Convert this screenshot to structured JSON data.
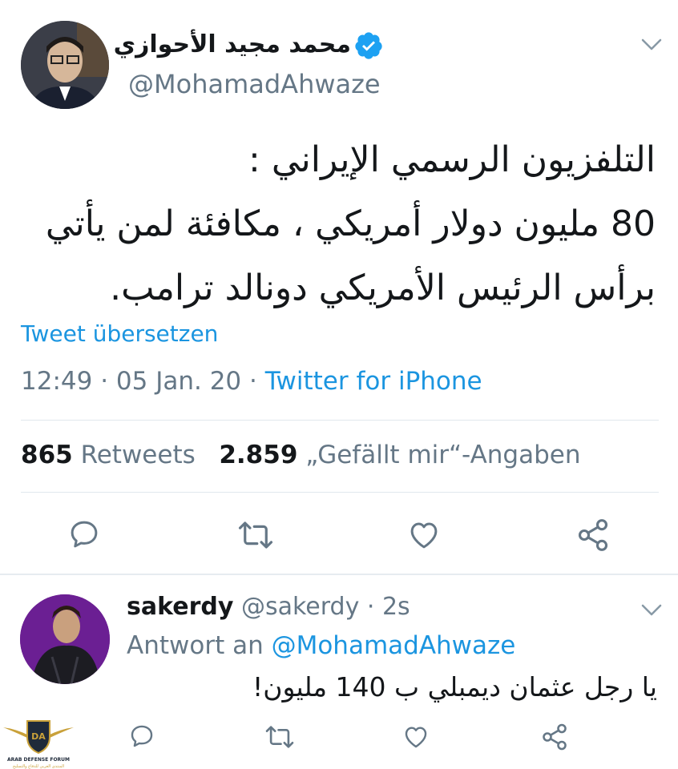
{
  "tweet": {
    "author_name": "محمد مجيد الأحوازي",
    "author_handle": "@MohamadAhwaze",
    "text_lines": [
      "التلفزيون الرسمي الإيراني :",
      "80 مليون دولار أمريكي ، مكافئة لمن يأتي",
      "برأس الرئيس الأمريكي دونالد ترامب."
    ],
    "translate_label": "Tweet übersetzen",
    "time": "12:49",
    "date": "05 Jan. 20",
    "source": "Twitter for iPhone",
    "retweets_count": "865",
    "retweets_label": "Retweets",
    "likes_count": "2.859",
    "likes_label": "„Gefällt mir“-Angaben"
  },
  "reply": {
    "author_name": "sakerdy",
    "author_handle": "@sakerdy",
    "time_ago": "2s",
    "reply_prefix": "Antwort an",
    "reply_to": "@MohamadAhwaze",
    "text": "يا رجل عثمان ديمبلي ب 140 مليون!"
  },
  "watermark": {
    "line1": "ARAB DEFENSE FORUM",
    "line2": "المنتدى العربي للدفاع والتسليح",
    "monogram": "DA"
  },
  "colors": {
    "accent": "#1b95e0",
    "text": "#14171a",
    "secondary": "#657786",
    "divider": "#e1e8ed"
  },
  "icons": {
    "verified": "verified-badge-icon",
    "menu": "chevron-down-icon",
    "reply": "reply-icon",
    "retweet": "retweet-icon",
    "like": "heart-icon",
    "share": "share-icon"
  }
}
